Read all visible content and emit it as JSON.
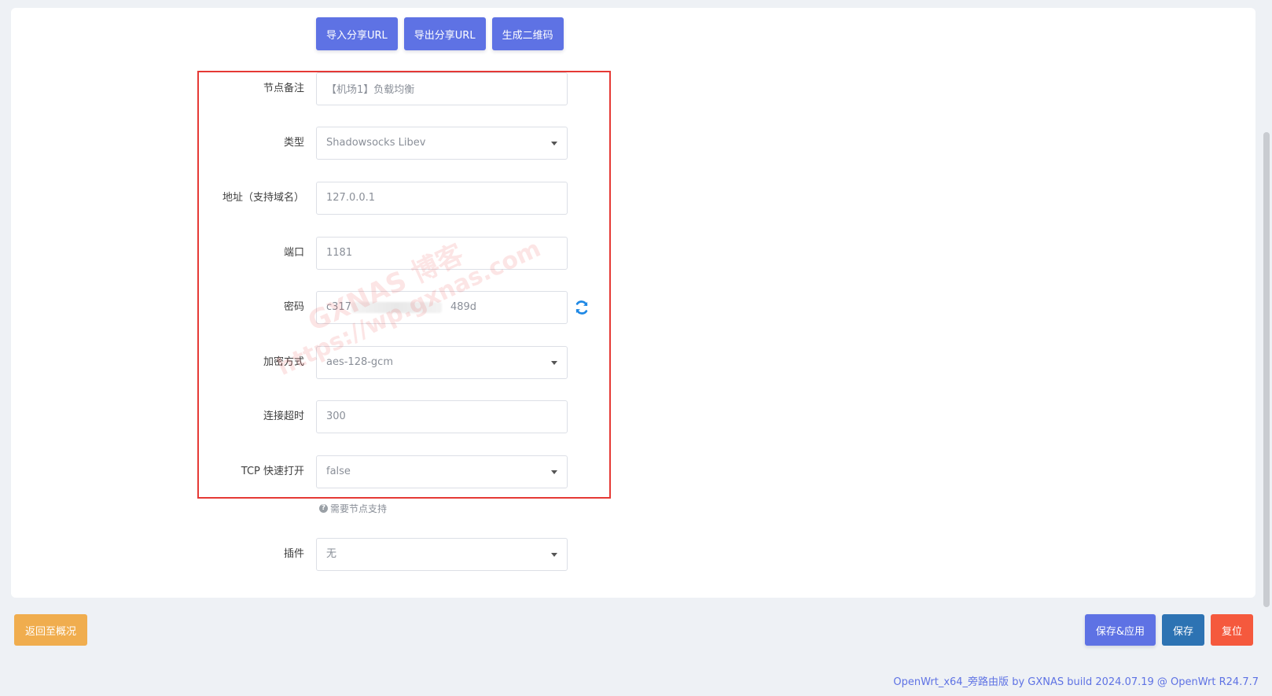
{
  "top_buttons": {
    "import_share_url": "导入分享URL",
    "export_share_url": "导出分享URL",
    "generate_qrcode": "生成二维码"
  },
  "form": {
    "remark": {
      "label": "节点备注",
      "value": "【机场1】负载均衡"
    },
    "type": {
      "label": "类型",
      "value": "Shadowsocks Libev"
    },
    "address": {
      "label": "地址（支持域名）",
      "value": "127.0.0.1"
    },
    "port": {
      "label": "端口",
      "value": "1181"
    },
    "password": {
      "label": "密码",
      "value_prefix": "c317",
      "value_suffix": "489d"
    },
    "encryption": {
      "label": "加密方式",
      "value": "aes-128-gcm"
    },
    "timeout": {
      "label": "连接超时",
      "value": "300"
    },
    "tcp_fast_open": {
      "label": "TCP 快速打开",
      "value": "false",
      "help": "需要节点支持"
    },
    "plugin": {
      "label": "插件",
      "value": "无"
    }
  },
  "watermark": {
    "line1": "GXNAS 博客",
    "line2": "https://wp.gxnas.com"
  },
  "bottom": {
    "back_label": "返回至概况",
    "save_apply_label": "保存&应用",
    "save_label": "保存",
    "reset_label": "复位"
  },
  "footer": {
    "text": "OpenWrt_x64_旁路由版 by GXNAS build 2024.07.19 @ OpenWrt R24.7.7"
  },
  "colors": {
    "primary": "#5e72e4",
    "save_blue": "#2d73b3",
    "reset_red": "#f5593d",
    "back_orange": "#f0ad4e",
    "highlight_red": "#e53935",
    "refresh_icon_blue": "#1e88e5"
  }
}
